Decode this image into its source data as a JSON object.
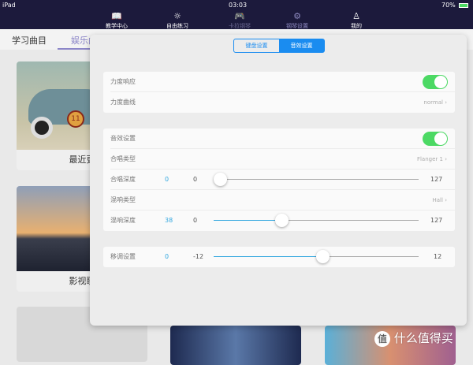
{
  "status": {
    "device": "iPad",
    "time": "03:03",
    "battery": "70%"
  },
  "nav": [
    {
      "label": "教学中心",
      "icon": "book-icon"
    },
    {
      "label": "自由练习",
      "icon": "sun-icon"
    },
    {
      "label": "卡拉钢琴",
      "icon": "gamepad-icon"
    },
    {
      "label": "钢琴设置",
      "icon": "gear-icon"
    },
    {
      "label": "我的",
      "icon": "person-icon"
    }
  ],
  "tabs": [
    "学习曲目",
    "娱乐曲"
  ],
  "tiles": [
    "最近更",
    "影视歌"
  ],
  "segment": [
    "键盘设置",
    "音效设置"
  ],
  "settings": {
    "velocity_response": "力度响应",
    "velocity_response_on": true,
    "velocity_curve": "力度曲线",
    "velocity_curve_value": "normal",
    "effects": "音效设置",
    "effects_on": true,
    "chorus_type": "合唱类型",
    "chorus_type_value": "Flanger 1",
    "chorus_depth": "合唱深度",
    "chorus_depth_value": "0",
    "chorus_min": "0",
    "chorus_max": "127",
    "reverb_type": "混响类型",
    "reverb_type_value": "Hall",
    "reverb_depth": "混响深度",
    "reverb_depth_value": "38",
    "reverb_min": "0",
    "reverb_max": "127",
    "transpose": "移调设置",
    "transpose_value": "0",
    "transpose_min": "-12",
    "transpose_max": "12"
  },
  "watermark": "什么值得买",
  "colors": {
    "accent": "#1a8cf0",
    "toggle": "#4cd964",
    "slider": "#35a8e0",
    "navbar": "#1c1a3c"
  }
}
